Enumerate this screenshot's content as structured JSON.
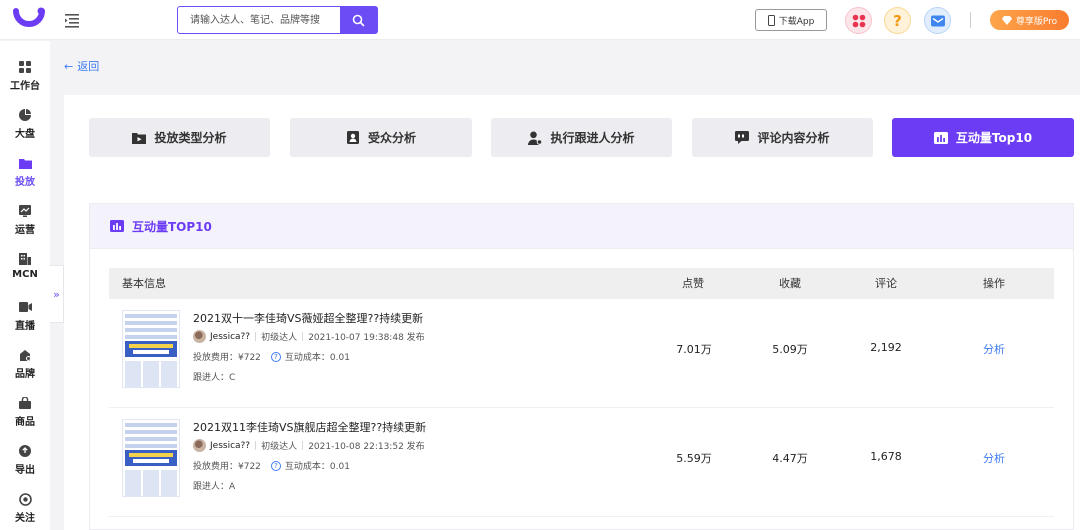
{
  "topbar": {
    "search_placeholder": "请输入达人、笔记、品牌等搜",
    "download_label": "下载App",
    "pro_label": "尊享版Pro"
  },
  "sidebar": {
    "items": [
      {
        "label": "工作台",
        "icon": "grid-icon"
      },
      {
        "label": "大盘",
        "icon": "pie-icon"
      },
      {
        "label": "投放",
        "icon": "folder-icon",
        "active": true
      },
      {
        "label": "运营",
        "icon": "trend-icon"
      },
      {
        "label": "MCN",
        "icon": "building-icon"
      },
      {
        "label": "直播",
        "icon": "video-icon"
      },
      {
        "label": "品牌",
        "icon": "brand-icon"
      },
      {
        "label": "商品",
        "icon": "bag-icon"
      },
      {
        "label": "导出",
        "icon": "export-icon"
      },
      {
        "label": "关注",
        "icon": "eye-icon"
      }
    ]
  },
  "back_label": "返回",
  "tabs": [
    {
      "label": "投放类型分析",
      "icon": "folder-play-icon"
    },
    {
      "label": "受众分析",
      "icon": "person-card-icon"
    },
    {
      "label": "执行跟进人分析",
      "icon": "user-gear-icon"
    },
    {
      "label": "评论内容分析",
      "icon": "comment-icon"
    },
    {
      "label": "互动量Top10",
      "icon": "bar-chart-icon",
      "active": true
    }
  ],
  "section": {
    "title": "互动量TOP10"
  },
  "table": {
    "headers": {
      "basic": "基本信息",
      "likes": "点赞",
      "favorites": "收藏",
      "comments": "评论",
      "action": "操作"
    },
    "rows": [
      {
        "title": "2021双十一李佳琦VS薇娅超全整理??持续更新",
        "author": "Jessica??",
        "level": "初级达人",
        "published": "2021-10-07 19:38:48 发布",
        "cost": "投放费用：¥722",
        "interaction_cost": "互动成本：0.01",
        "follower": "跟进人：C",
        "likes": "7.01万",
        "favorites": "5.09万",
        "comments": "2,192",
        "action": "分析"
      },
      {
        "title": "2021双11李佳琦VS旗舰店超全整理??持续更新",
        "author": "Jessica??",
        "level": "初级达人",
        "published": "2021-10-08 22:13:52 发布",
        "cost": "投放费用：¥722",
        "interaction_cost": "互动成本：0.01",
        "follower": "跟进人：A",
        "likes": "5.59万",
        "favorites": "4.47万",
        "comments": "1,678",
        "action": "分析"
      }
    ]
  },
  "colors": {
    "accent": "#6c3cf5",
    "link": "#3f7cf5",
    "pro_gradient_start": "#fda54b",
    "pro_gradient_end": "#f97c2e"
  }
}
